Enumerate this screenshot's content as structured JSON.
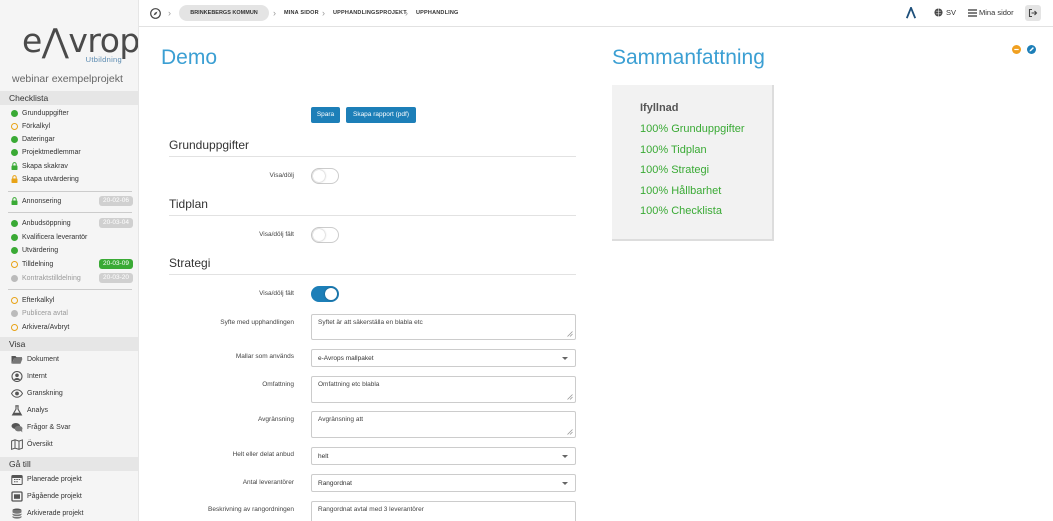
{
  "sidebar": {
    "logo_main": "e⋀vrop",
    "logo_sub": "Utbildning",
    "project": "webinar exempelprojekt",
    "checklist_title": "Checklista",
    "checklist": [
      {
        "label": "Grunduppgifter",
        "state": "green"
      },
      {
        "label": "Förkalkyl",
        "state": "ring"
      },
      {
        "label": "Dateringar",
        "state": "green"
      },
      {
        "label": "Projektmedlemmar",
        "state": "green"
      },
      {
        "label": "Skapa skakrav",
        "state": "lock-green"
      },
      {
        "label": "Skapa utvärdering",
        "state": "lock-orange"
      }
    ],
    "annonsering": {
      "label": "Annonsering",
      "date": "20-02-06"
    },
    "phase": [
      {
        "label": "Anbudsöppning",
        "date": "20-03-04",
        "state": "green"
      },
      {
        "label": "Kvalificera leverantör",
        "date": "",
        "state": "green"
      },
      {
        "label": "Utvärdering",
        "date": "",
        "state": "green"
      },
      {
        "label": "Tilldelning",
        "date": "20-03-09",
        "state": "ring"
      },
      {
        "label": "Kontraktstilldelning",
        "date": "20-03-20",
        "state": "grey"
      }
    ],
    "after": [
      {
        "label": "Efterkalkyl",
        "state": "ring"
      },
      {
        "label": "Publicera avtal",
        "state": "grey"
      },
      {
        "label": "Arkivera/Avbryt",
        "state": "ring"
      }
    ],
    "view_title": "Visa",
    "views": [
      "Dokument",
      "Internt",
      "Granskning",
      "Analys",
      "Frågor & Svar",
      "Översikt"
    ],
    "goto_title": "Gå till",
    "goto": [
      "Planerade projekt",
      "Pågående projekt",
      "Arkiverade projekt"
    ]
  },
  "topbar": {
    "crumbs": [
      "BRINKEBERGS KOMMUN",
      "MINA SIDOR",
      "UPPHANDLINGSPROJEKT",
      "UPPHANDLING"
    ],
    "lang": "SV",
    "my_pages": "Mina sidor"
  },
  "main": {
    "title": "Demo",
    "save_label": "Spara",
    "report_label": "Skapa rapport (pdf)",
    "sections": {
      "grund": "Grunduppgifter",
      "tidplan": "Tidplan",
      "strategi": "Strategi"
    },
    "labels": {
      "visa_dolj": "Visa/dölj",
      "visa_dolj_falt": "Visa/dölj fält",
      "visa_dolj_falt2": "Visa/dölj fält",
      "syfte": "Syfte med upphandlingen",
      "mallar": "Mallar som används",
      "omfattning": "Omfattning",
      "avgransning": "Avgränsning",
      "helt": "Helt eller delat anbud",
      "antal": "Antal leverantörer",
      "beskrivning": "Beskrivning av rangordningen"
    },
    "values": {
      "syfte": "Syftet är att säkerställa en blabla etc",
      "mallar": "e-Avrops mallpaket",
      "omfattning": "Omfattning etc blabla",
      "avgransning": "Avgränsning att",
      "helt": "helt",
      "antal": "Rangordnat",
      "beskrivning": "Rangordnat avtal med 3 leverantörer"
    }
  },
  "summary": {
    "title": "Sammanfattning",
    "heading": "Ifyllnad",
    "rows": [
      "100% Grunduppgifter",
      "100% Tidplan",
      "100% Strategi",
      "100% Hållbarhet",
      "100% Checklista"
    ]
  },
  "colors": {
    "accent": "#3b9fd3",
    "button": "#1d7fb8",
    "ok": "#3aaa35",
    "warn": "#e8a317"
  }
}
